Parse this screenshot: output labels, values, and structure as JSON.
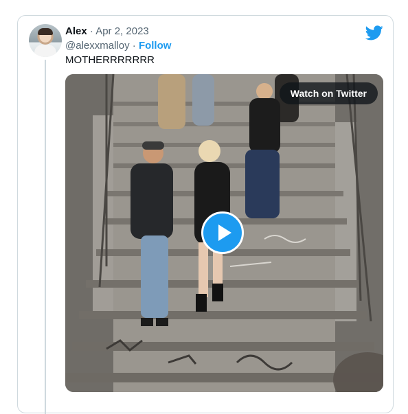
{
  "tweet": {
    "author_name": "Alex",
    "separator": "·",
    "date": "Apr 2, 2023",
    "handle": "@alexxmalloy",
    "follow_label": "Follow",
    "text": "MOTHERRRRRRR",
    "avatar_icon": "user-avatar",
    "brand_icon": "twitter-bird-icon",
    "brand_color": "#1d9bf0"
  },
  "media": {
    "type": "video",
    "watch_label": "Watch on Twitter",
    "play_icon": "play-icon",
    "play_color": "#1d9bf0"
  }
}
